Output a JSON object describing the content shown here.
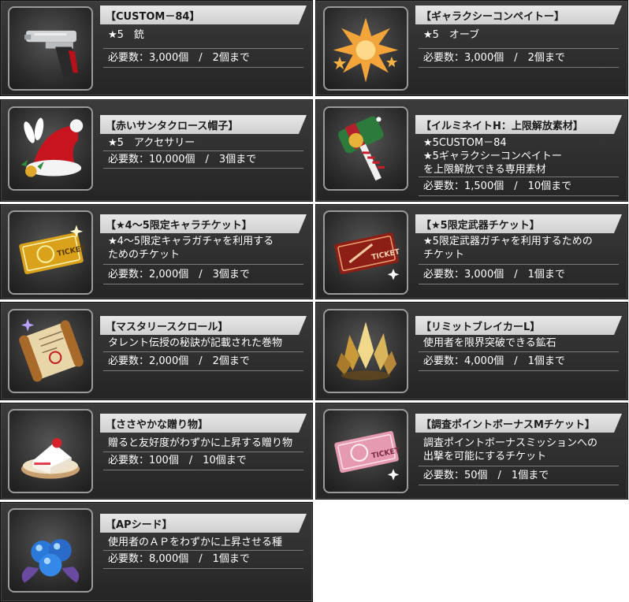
{
  "items": [
    {
      "name": "【CUSTOM－84】",
      "desc": [
        "★5　銃"
      ],
      "req": "必要数：3,000個　/　2個まで",
      "icon": "pistol-icon"
    },
    {
      "name": "【ギャラクシーコンペイトー】",
      "desc": [
        "★5　オーブ"
      ],
      "req": "必要数：3,000個　/　2個まで",
      "icon": "star-candy-icon"
    },
    {
      "name": "【赤いサンタクロース帽子】",
      "desc": [
        "★5　アクセサリー"
      ],
      "req": "必要数：10,000個　/　3個まで",
      "icon": "santa-hat-icon"
    },
    {
      "name": "【イルミネイトH：上限解放素材】",
      "desc": [
        "★5CUSTOM－84",
        "★5ギャラクシーコンペイトー",
        "を上限解放できる専用素材"
      ],
      "req": "必要数：1,500個　/　10個まで",
      "icon": "hammer-icon"
    },
    {
      "name": "【★4～5限定キャラチケット】",
      "desc": [
        "★4～5限定キャラガチャを利用する",
        "ためのチケット"
      ],
      "req": "必要数：2,000個　/　3個まで",
      "icon": "gold-ticket-icon"
    },
    {
      "name": "【★5限定武器チケット】",
      "desc": [
        "★5限定武器ガチャを利用するための",
        "チケット"
      ],
      "req": "必要数：3,000個　/　1個まで",
      "icon": "red-ticket-icon"
    },
    {
      "name": "【マスタリースクロール】",
      "desc": [
        "タレント伝授の秘訣が記載された巻物"
      ],
      "req": "必要数：2,000個　/　2個まで",
      "icon": "scroll-icon"
    },
    {
      "name": "【リミットブレイカーL】",
      "desc": [
        "使用者を限界突破できる鉱石"
      ],
      "req": "必要数：4,000個　/　1個まで",
      "icon": "crystal-icon"
    },
    {
      "name": "【ささやかな贈り物】",
      "desc": [
        "贈ると友好度がわずかに上昇する贈り物"
      ],
      "req": "必要数：100個　/　10個まで",
      "icon": "cake-icon"
    },
    {
      "name": "【調査ポイントボーナスMチケット】",
      "desc": [
        "調査ポイントボーナスミッションへの",
        "出撃を可能にするチケット"
      ],
      "req": "必要数：50個　/　1個まで",
      "icon": "pink-ticket-icon"
    },
    {
      "name": "【APシード】",
      "desc": [
        "使用者のＡＰをわずかに上昇させる種"
      ],
      "req": "必要数：8,000個　/　1個まで",
      "icon": "blue-seeds-icon"
    }
  ]
}
